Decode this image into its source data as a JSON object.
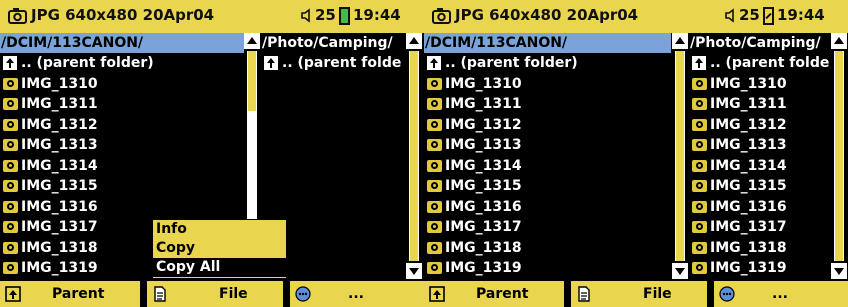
{
  "screens": [
    {
      "status": {
        "file_info": "JPG 640x480 20Apr04",
        "volume": "25",
        "clock": "19:44",
        "battery": "full"
      },
      "left_pane": {
        "path": "/DCIM/113CANON/",
        "items": [
          {
            "label": ".. (parent folder)",
            "kind": "parent"
          },
          {
            "label": "IMG_1310",
            "kind": "image"
          },
          {
            "label": "IMG_1311",
            "kind": "image"
          },
          {
            "label": "IMG_1312",
            "kind": "image"
          },
          {
            "label": "IMG_1313",
            "kind": "image"
          },
          {
            "label": "IMG_1314",
            "kind": "image"
          },
          {
            "label": "IMG_1315",
            "kind": "image"
          },
          {
            "label": "IMG_1316",
            "kind": "image"
          },
          {
            "label": "IMG_1317",
            "kind": "image"
          },
          {
            "label": "IMG_1318",
            "kind": "image"
          },
          {
            "label": "IMG_1319",
            "kind": "image"
          }
        ]
      },
      "right_pane": {
        "path": "/Photo/Camping/",
        "items": [
          {
            "label": ".. (parent folde",
            "kind": "parent"
          }
        ]
      },
      "context_menu": {
        "visible": true,
        "items": [
          {
            "label": "Info",
            "selected": false
          },
          {
            "label": "Copy",
            "selected": false
          },
          {
            "label": "Copy All",
            "selected": true
          }
        ]
      },
      "buttons": {
        "parent": "Parent",
        "file": "File",
        "more": "..."
      }
    },
    {
      "status": {
        "file_info": "JPG 640x480 20Apr04",
        "volume": "25",
        "clock": "19:44",
        "battery": "charging"
      },
      "left_pane": {
        "path": "/DCIM/113CANON/",
        "items": [
          {
            "label": ".. (parent folder)",
            "kind": "parent"
          },
          {
            "label": "IMG_1310",
            "kind": "image"
          },
          {
            "label": "IMG_1311",
            "kind": "image"
          },
          {
            "label": "IMG_1312",
            "kind": "image"
          },
          {
            "label": "IMG_1313",
            "kind": "image"
          },
          {
            "label": "IMG_1314",
            "kind": "image"
          },
          {
            "label": "IMG_1315",
            "kind": "image"
          },
          {
            "label": "IMG_1316",
            "kind": "image"
          },
          {
            "label": "IMG_1317",
            "kind": "image"
          },
          {
            "label": "IMG_1318",
            "kind": "image"
          },
          {
            "label": "IMG_1319",
            "kind": "image"
          }
        ]
      },
      "right_pane": {
        "path": "/Photo/Camping/",
        "items": [
          {
            "label": ".. (parent folde",
            "kind": "parent"
          },
          {
            "label": "IMG_1310",
            "kind": "image"
          },
          {
            "label": "IMG_1311",
            "kind": "image"
          },
          {
            "label": "IMG_1312",
            "kind": "image"
          },
          {
            "label": "IMG_1313",
            "kind": "image"
          },
          {
            "label": "IMG_1314",
            "kind": "image"
          },
          {
            "label": "IMG_1315",
            "kind": "image"
          },
          {
            "label": "IMG_1316",
            "kind": "image"
          },
          {
            "label": "IMG_1317",
            "kind": "image"
          },
          {
            "label": "IMG_1318",
            "kind": "image"
          },
          {
            "label": "IMG_1319",
            "kind": "image"
          }
        ]
      },
      "context_menu": {
        "visible": false,
        "items": []
      },
      "buttons": {
        "parent": "Parent",
        "file": "File",
        "more": "..."
      }
    }
  ],
  "icons": {
    "parent": "folder-up-icon",
    "image": "jpeg-file-icon",
    "file": "file-icon",
    "more": "more-options-icon",
    "camera": "camera-icon",
    "speaker": "speaker-icon",
    "battery": "battery-icon"
  },
  "colors": {
    "bar": "#e9d54e",
    "highlight": "#7ba3d9",
    "background": "#000000",
    "text": "#ffffff",
    "battery_full": "#3fbf4a"
  }
}
